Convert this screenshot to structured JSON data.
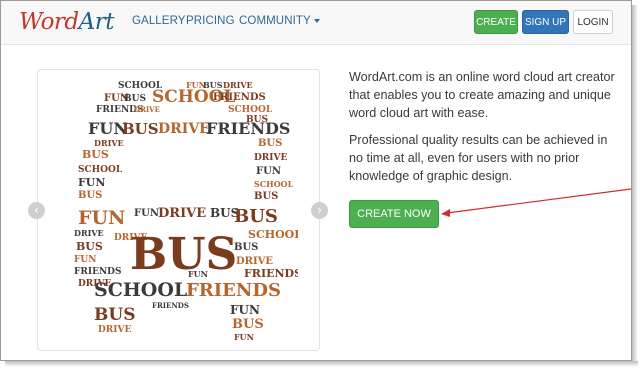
{
  "brand": {
    "logo_word": "Word",
    "logo_art": "Art"
  },
  "nav": {
    "gallery": "GALLERY",
    "pricing": "PRICING",
    "community": "COMMUNITY"
  },
  "actions": {
    "create": "CREATE",
    "signup": "SIGN UP",
    "login": "LOGIN"
  },
  "hero": {
    "paragraph_1": "WordArt.com is an online word cloud art creator that enables you to create amazing and unique word cloud art with ease.",
    "paragraph_2": "Professional quality results can be achieved in no time at all, even for users with no prior knowledge of graphic design.",
    "cta_label": "CREATE NOW"
  },
  "carousel": {
    "prev_icon": "chevron-left-icon",
    "next_icon": "chevron-right-icon"
  },
  "cloud_words": {
    "bus": "BUS",
    "school": "SCHOOL",
    "fun": "FUN",
    "drive": "DRIVE",
    "friends": "FRIENDS"
  },
  "colors": {
    "word_brown": "#7a3b1f",
    "word_orange": "#b5652d",
    "word_dark": "#3d3a3a",
    "accent_green": "#4caf50",
    "accent_blue": "#3275b8",
    "link_blue": "#2d6a94",
    "annotation_red": "#d62b2b"
  }
}
